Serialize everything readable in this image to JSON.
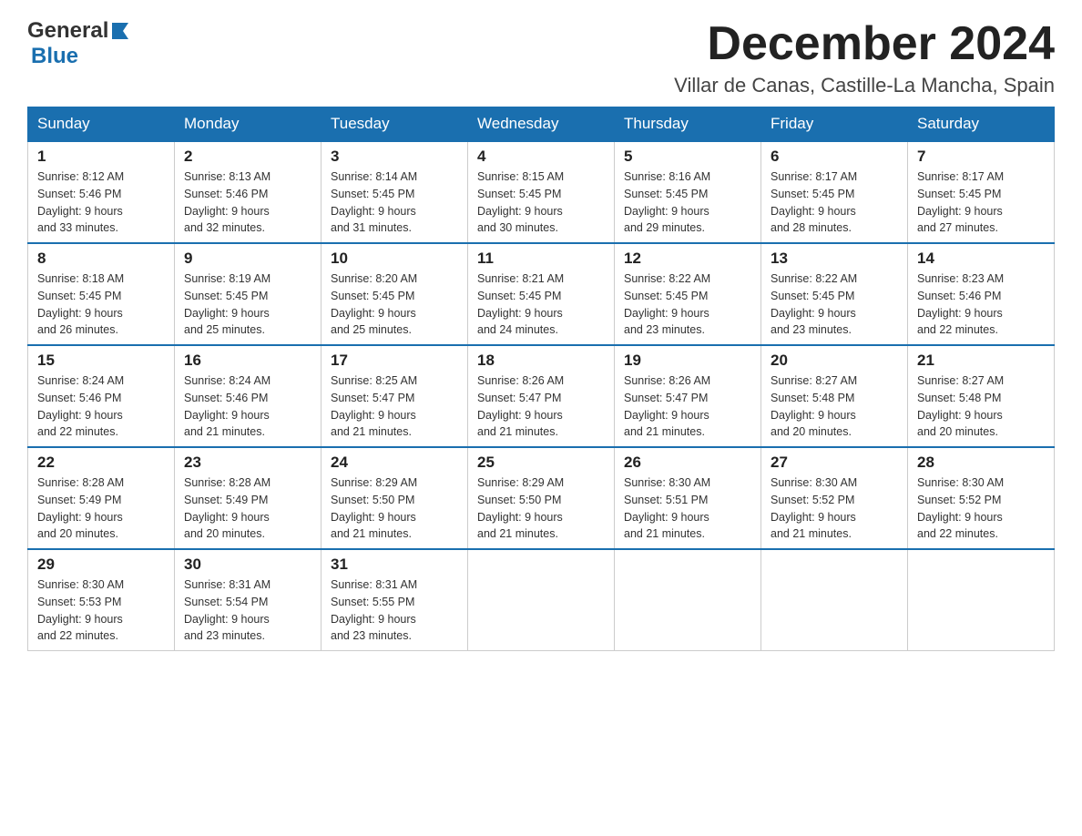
{
  "header": {
    "logo_general": "General",
    "logo_blue": "Blue",
    "month_title": "December 2024",
    "location": "Villar de Canas, Castille-La Mancha, Spain"
  },
  "weekdays": [
    "Sunday",
    "Monday",
    "Tuesday",
    "Wednesday",
    "Thursday",
    "Friday",
    "Saturday"
  ],
  "weeks": [
    [
      {
        "day": "1",
        "sunrise": "8:12 AM",
        "sunset": "5:46 PM",
        "daylight": "9 hours and 33 minutes."
      },
      {
        "day": "2",
        "sunrise": "8:13 AM",
        "sunset": "5:46 PM",
        "daylight": "9 hours and 32 minutes."
      },
      {
        "day": "3",
        "sunrise": "8:14 AM",
        "sunset": "5:45 PM",
        "daylight": "9 hours and 31 minutes."
      },
      {
        "day": "4",
        "sunrise": "8:15 AM",
        "sunset": "5:45 PM",
        "daylight": "9 hours and 30 minutes."
      },
      {
        "day": "5",
        "sunrise": "8:16 AM",
        "sunset": "5:45 PM",
        "daylight": "9 hours and 29 minutes."
      },
      {
        "day": "6",
        "sunrise": "8:17 AM",
        "sunset": "5:45 PM",
        "daylight": "9 hours and 28 minutes."
      },
      {
        "day": "7",
        "sunrise": "8:17 AM",
        "sunset": "5:45 PM",
        "daylight": "9 hours and 27 minutes."
      }
    ],
    [
      {
        "day": "8",
        "sunrise": "8:18 AM",
        "sunset": "5:45 PM",
        "daylight": "9 hours and 26 minutes."
      },
      {
        "day": "9",
        "sunrise": "8:19 AM",
        "sunset": "5:45 PM",
        "daylight": "9 hours and 25 minutes."
      },
      {
        "day": "10",
        "sunrise": "8:20 AM",
        "sunset": "5:45 PM",
        "daylight": "9 hours and 25 minutes."
      },
      {
        "day": "11",
        "sunrise": "8:21 AM",
        "sunset": "5:45 PM",
        "daylight": "9 hours and 24 minutes."
      },
      {
        "day": "12",
        "sunrise": "8:22 AM",
        "sunset": "5:45 PM",
        "daylight": "9 hours and 23 minutes."
      },
      {
        "day": "13",
        "sunrise": "8:22 AM",
        "sunset": "5:45 PM",
        "daylight": "9 hours and 23 minutes."
      },
      {
        "day": "14",
        "sunrise": "8:23 AM",
        "sunset": "5:46 PM",
        "daylight": "9 hours and 22 minutes."
      }
    ],
    [
      {
        "day": "15",
        "sunrise": "8:24 AM",
        "sunset": "5:46 PM",
        "daylight": "9 hours and 22 minutes."
      },
      {
        "day": "16",
        "sunrise": "8:24 AM",
        "sunset": "5:46 PM",
        "daylight": "9 hours and 21 minutes."
      },
      {
        "day": "17",
        "sunrise": "8:25 AM",
        "sunset": "5:47 PM",
        "daylight": "9 hours and 21 minutes."
      },
      {
        "day": "18",
        "sunrise": "8:26 AM",
        "sunset": "5:47 PM",
        "daylight": "9 hours and 21 minutes."
      },
      {
        "day": "19",
        "sunrise": "8:26 AM",
        "sunset": "5:47 PM",
        "daylight": "9 hours and 21 minutes."
      },
      {
        "day": "20",
        "sunrise": "8:27 AM",
        "sunset": "5:48 PM",
        "daylight": "9 hours and 20 minutes."
      },
      {
        "day": "21",
        "sunrise": "8:27 AM",
        "sunset": "5:48 PM",
        "daylight": "9 hours and 20 minutes."
      }
    ],
    [
      {
        "day": "22",
        "sunrise": "8:28 AM",
        "sunset": "5:49 PM",
        "daylight": "9 hours and 20 minutes."
      },
      {
        "day": "23",
        "sunrise": "8:28 AM",
        "sunset": "5:49 PM",
        "daylight": "9 hours and 20 minutes."
      },
      {
        "day": "24",
        "sunrise": "8:29 AM",
        "sunset": "5:50 PM",
        "daylight": "9 hours and 21 minutes."
      },
      {
        "day": "25",
        "sunrise": "8:29 AM",
        "sunset": "5:50 PM",
        "daylight": "9 hours and 21 minutes."
      },
      {
        "day": "26",
        "sunrise": "8:30 AM",
        "sunset": "5:51 PM",
        "daylight": "9 hours and 21 minutes."
      },
      {
        "day": "27",
        "sunrise": "8:30 AM",
        "sunset": "5:52 PM",
        "daylight": "9 hours and 21 minutes."
      },
      {
        "day": "28",
        "sunrise": "8:30 AM",
        "sunset": "5:52 PM",
        "daylight": "9 hours and 22 minutes."
      }
    ],
    [
      {
        "day": "29",
        "sunrise": "8:30 AM",
        "sunset": "5:53 PM",
        "daylight": "9 hours and 22 minutes."
      },
      {
        "day": "30",
        "sunrise": "8:31 AM",
        "sunset": "5:54 PM",
        "daylight": "9 hours and 23 minutes."
      },
      {
        "day": "31",
        "sunrise": "8:31 AM",
        "sunset": "5:55 PM",
        "daylight": "9 hours and 23 minutes."
      },
      null,
      null,
      null,
      null
    ]
  ],
  "labels": {
    "sunrise": "Sunrise:",
    "sunset": "Sunset:",
    "daylight": "Daylight:"
  }
}
